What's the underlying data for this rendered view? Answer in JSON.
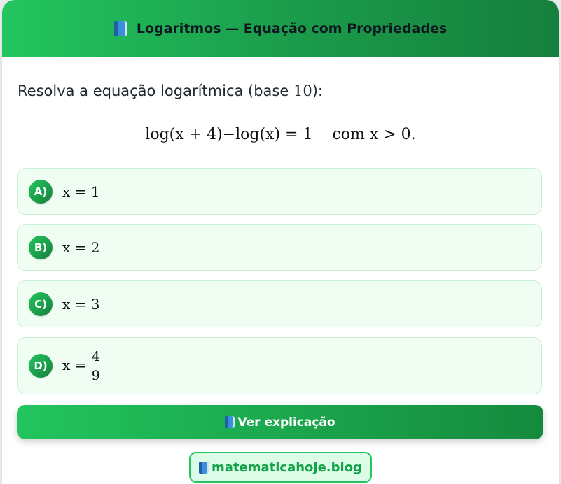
{
  "header": {
    "title": "Logaritmos — Equação com Propriedades",
    "icon": "book-icon"
  },
  "question": {
    "text": "Resolva a equação logarítmica (base ",
    "base": "10",
    "suffix": "):"
  },
  "equation": {
    "lhs": "log(x + 4)−log(x) = 1",
    "condition": "com x > 0."
  },
  "options": [
    {
      "letter": "A)",
      "text": "x = 1"
    },
    {
      "letter": "B)",
      "text": "x = 2"
    },
    {
      "letter": "C)",
      "text": "x = 3"
    },
    {
      "letter": "D)",
      "prefix": "x = ",
      "numerator": "4",
      "denominator": "9"
    }
  ],
  "explain_button": {
    "label": "Ver explicação",
    "icon": "book-icon"
  },
  "site_badge": {
    "label": "matematicahoje.blog",
    "icon": "book-icon"
  },
  "colors": {
    "accent": "#22c55e",
    "accent_dark": "#15803d",
    "option_bg": "#effdf3"
  }
}
